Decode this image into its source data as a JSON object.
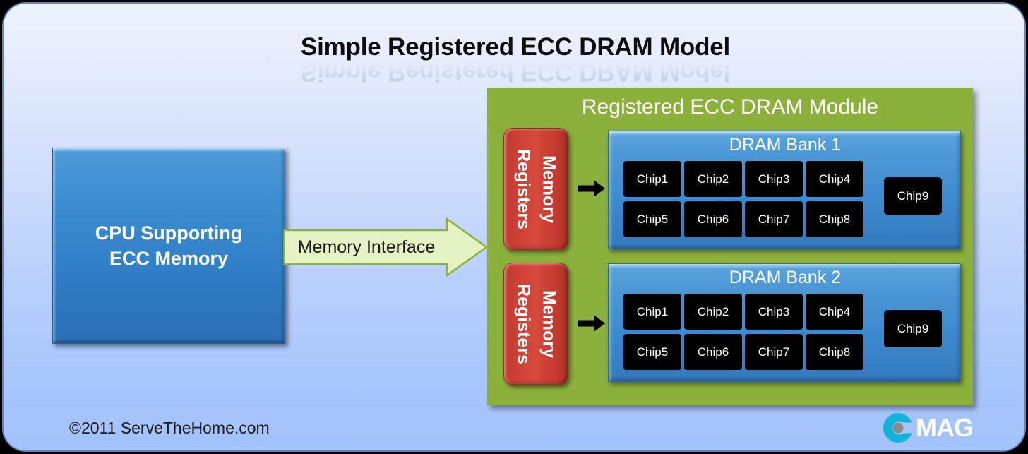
{
  "title": "Simple Registered ECC DRAM Model",
  "cpu": {
    "label": "CPU Supporting\nECC Memory"
  },
  "interface_arrow": {
    "label": "Memory Interface"
  },
  "module": {
    "title": "Registered ECC DRAM Module",
    "registers": [
      {
        "label": "Memory\nRegisters"
      },
      {
        "label": "Memory\nRegisters"
      }
    ],
    "banks": [
      {
        "title": "DRAM Bank 1",
        "chips": [
          "Chip1",
          "Chip2",
          "Chip3",
          "Chip4",
          "Chip5",
          "Chip6",
          "Chip7",
          "Chip8"
        ],
        "ecc_chip": "Chip9"
      },
      {
        "title": "DRAM Bank 2",
        "chips": [
          "Chip1",
          "Chip2",
          "Chip3",
          "Chip4",
          "Chip5",
          "Chip6",
          "Chip7",
          "Chip8"
        ],
        "ecc_chip": "Chip9"
      }
    ]
  },
  "footer": {
    "copyright": "©2011 ServeTheHome.com",
    "logo_text": "MAG",
    "logo_mark": "c-circle-icon"
  },
  "colors": {
    "module_green": "#8cb03c",
    "bank_blue": "#4b97d6",
    "cpu_blue": "#3c8dd2",
    "register_red": "#cf4136",
    "chip_black": "#000000",
    "arrow_green_fill": "#e4f2c4",
    "arrow_green_border": "#8cb03c",
    "logo_cyan": "#10b4d8",
    "logo_dot_gray": "#8a8a8a",
    "slide_border": "#5b87c4",
    "outer_background": "#000000"
  }
}
